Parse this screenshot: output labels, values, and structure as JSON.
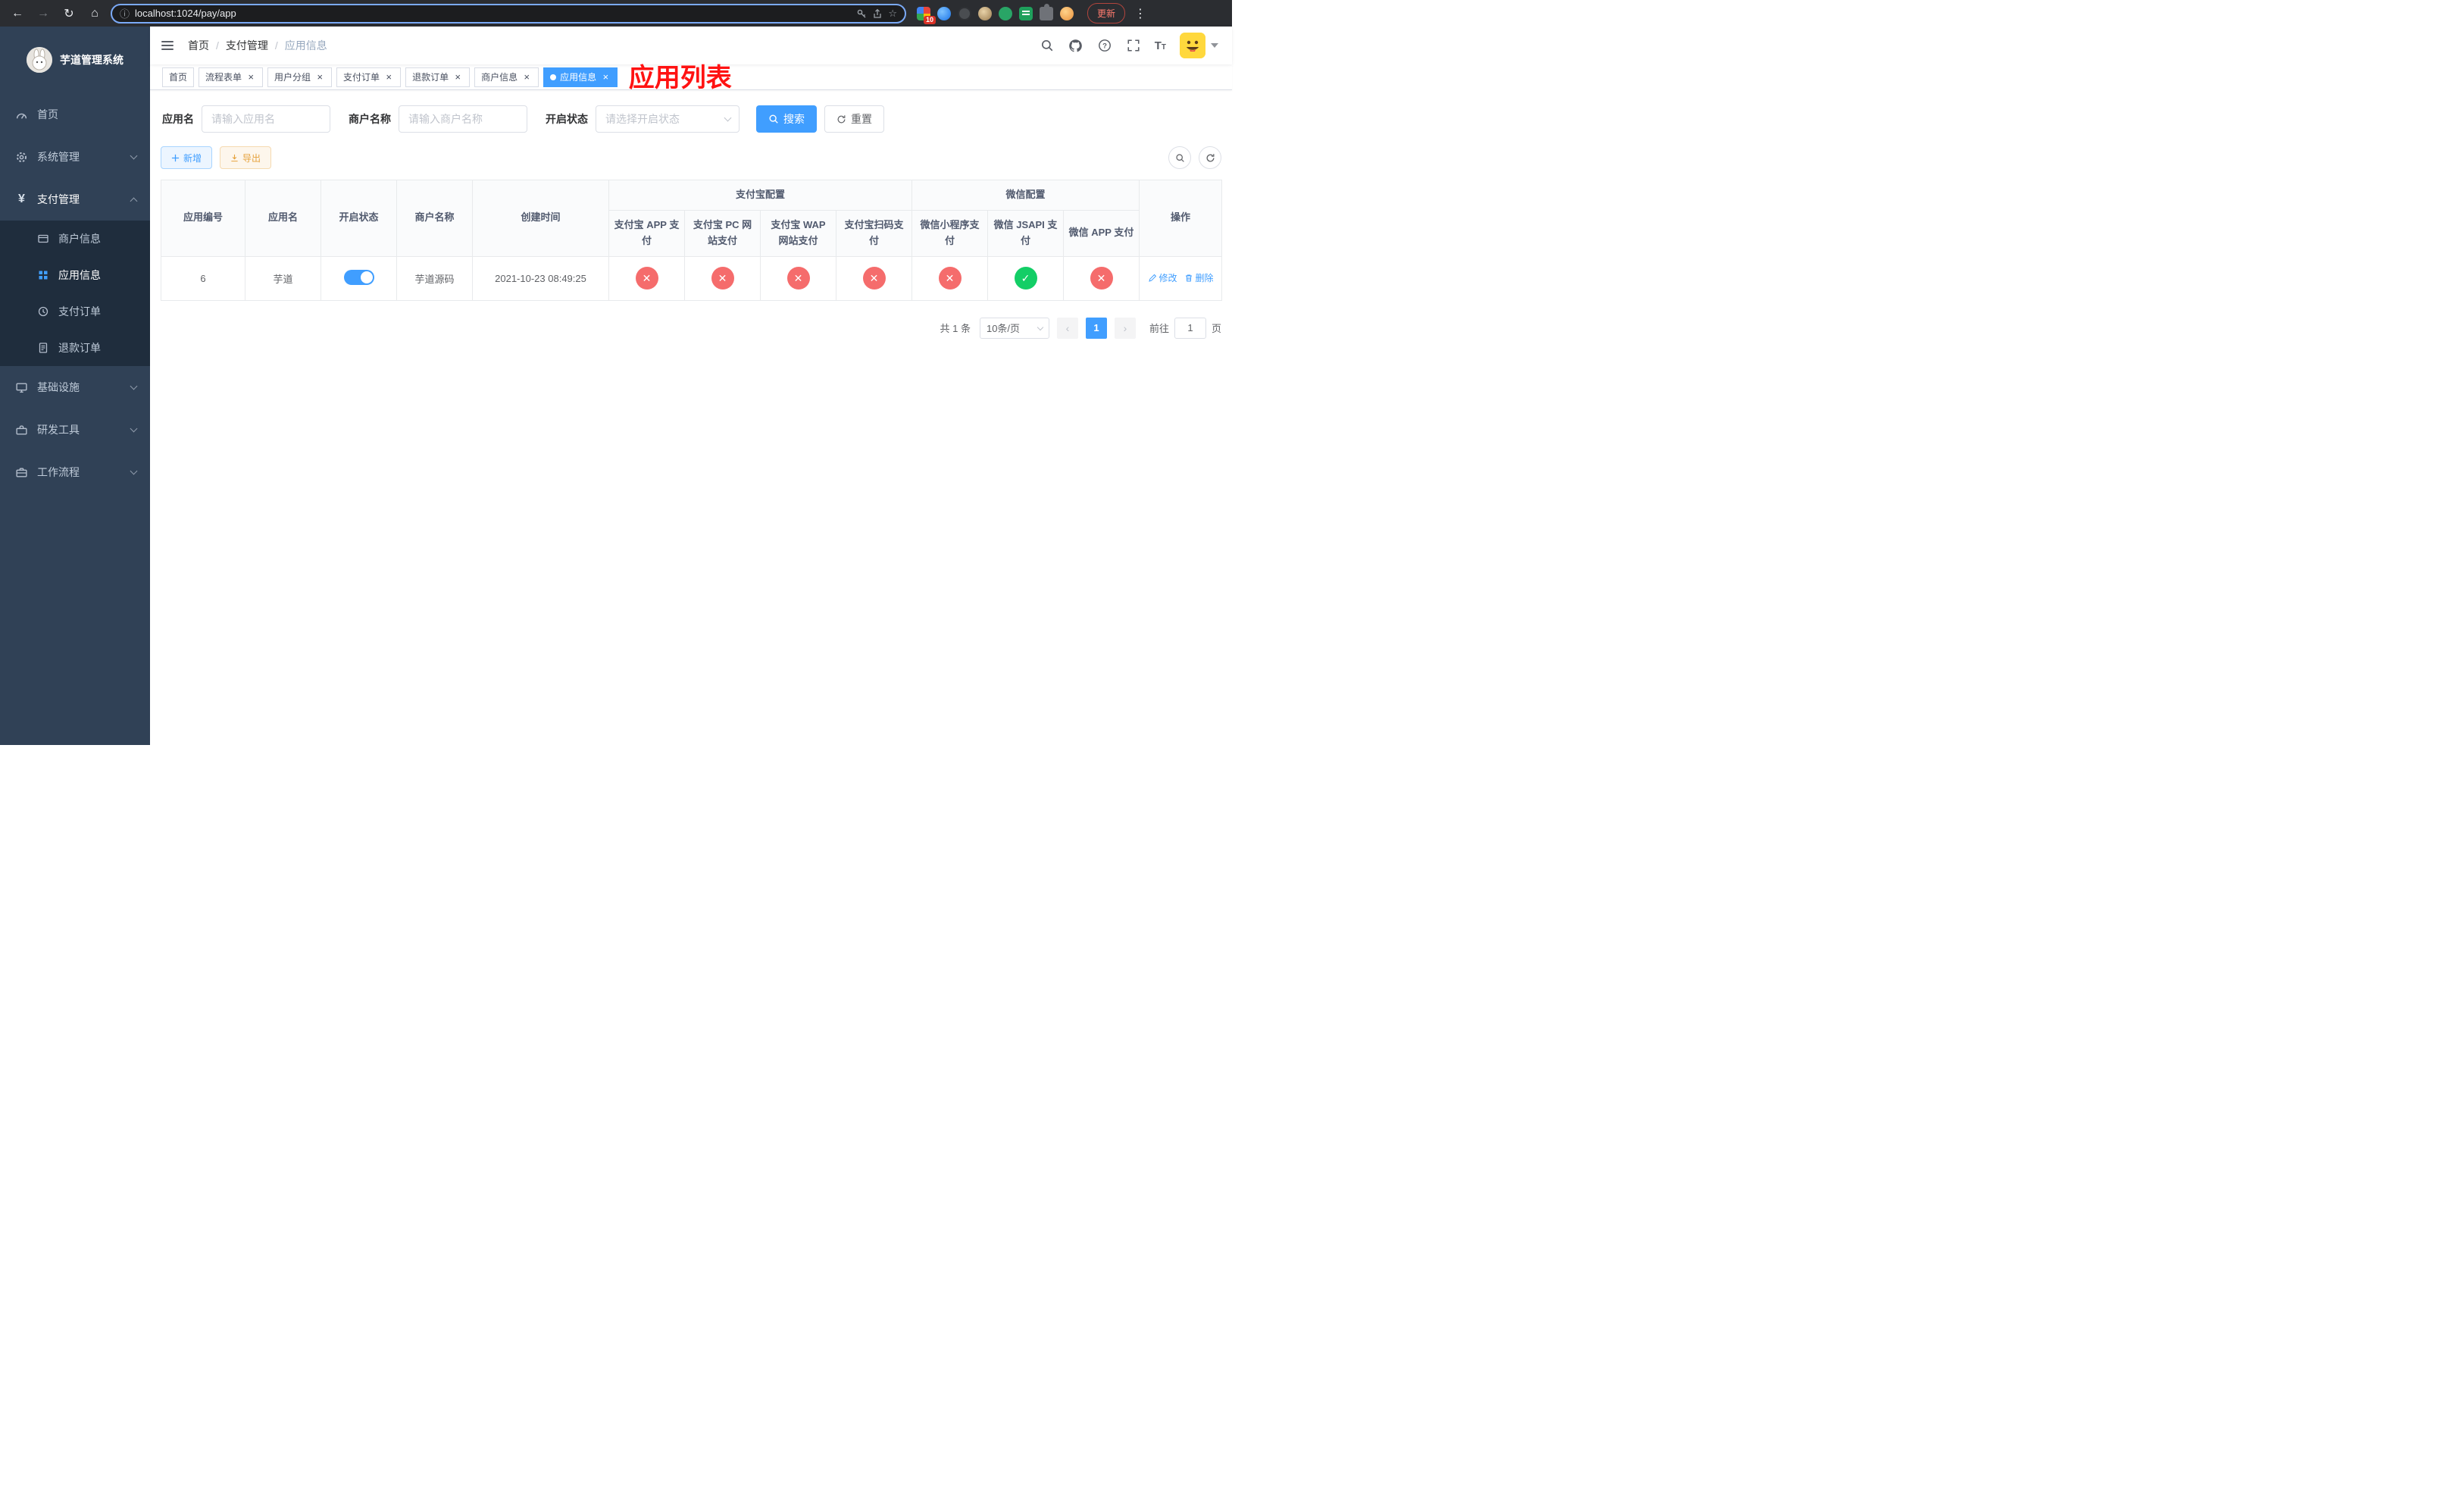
{
  "colors": {
    "accent": "#409EFF",
    "success": "#13ce66",
    "danger": "#f56c6c",
    "warning": "#e6a23c",
    "sidebar_bg": "#304156",
    "submenu_bg": "#1f2d3d"
  },
  "browser": {
    "url": "localhost:1024/pay/app",
    "update_label": "更新",
    "extension_badge": "10"
  },
  "annotation": {
    "title": "应用列表"
  },
  "sidebar": {
    "title": "芋道管理系统",
    "items": [
      {
        "label": "首页",
        "icon": "dashboard-icon"
      },
      {
        "label": "系统管理",
        "icon": "gear-icon"
      },
      {
        "label": "支付管理",
        "icon": "yen-icon",
        "expanded": true,
        "children": [
          {
            "label": "商户信息",
            "icon": "card-icon"
          },
          {
            "label": "应用信息",
            "icon": "grid-icon",
            "active": true
          },
          {
            "label": "支付订单",
            "icon": "order-icon"
          },
          {
            "label": "退款订单",
            "icon": "refund-icon"
          }
        ]
      },
      {
        "label": "基础设施",
        "icon": "monitor-icon"
      },
      {
        "label": "研发工具",
        "icon": "toolbox-icon"
      },
      {
        "label": "工作流程",
        "icon": "briefcase-icon"
      }
    ]
  },
  "header": {
    "breadcrumb": [
      "首页",
      "支付管理",
      "应用信息"
    ]
  },
  "tabs": [
    {
      "label": "首页"
    },
    {
      "label": "流程表单"
    },
    {
      "label": "用户分组"
    },
    {
      "label": "支付订单"
    },
    {
      "label": "退款订单"
    },
    {
      "label": "商户信息"
    },
    {
      "label": "应用信息"
    }
  ],
  "filters": {
    "app_name_label": "应用名",
    "app_name_placeholder": "请输入应用名",
    "merchant_label": "商户名称",
    "merchant_placeholder": "请输入商户名称",
    "status_label": "开启状态",
    "status_placeholder": "请选择开启状态",
    "search_label": "搜索",
    "reset_label": "重置"
  },
  "toolbar": {
    "add_label": "新增",
    "export_label": "导出"
  },
  "table": {
    "headers": {
      "app_id": "应用编号",
      "app_name": "应用名",
      "status": "开启状态",
      "merchant": "商户名称",
      "created": "创建时间",
      "alipay_group": "支付宝配置",
      "wechat_group": "微信配置",
      "alipay_app": "支付宝 APP 支付",
      "alipay_pc": "支付宝 PC 网站支付",
      "alipay_wap": "支付宝 WAP 网站支付",
      "alipay_qr": "支付宝扫码支付",
      "wx_lite": "微信小程序支付",
      "wx_jsapi": "微信 JSAPI 支付",
      "wx_app": "微信 APP 支付",
      "actions": "操作"
    },
    "rows": [
      {
        "app_id": "6",
        "app_name": "芋道",
        "status_on": true,
        "merchant": "芋道源码",
        "created": "2021-10-23 08:49:25",
        "configs": {
          "alipay_app": false,
          "alipay_pc": false,
          "alipay_wap": false,
          "alipay_qr": false,
          "wx_lite": false,
          "wx_jsapi": true,
          "wx_app": false
        },
        "edit_label": "修改",
        "delete_label": "删除"
      }
    ]
  },
  "pagination": {
    "total": "共 1 条",
    "page_size": "10条/页",
    "page": "1",
    "goto_label": "前往",
    "goto_value": "1",
    "unit_label": "页"
  }
}
